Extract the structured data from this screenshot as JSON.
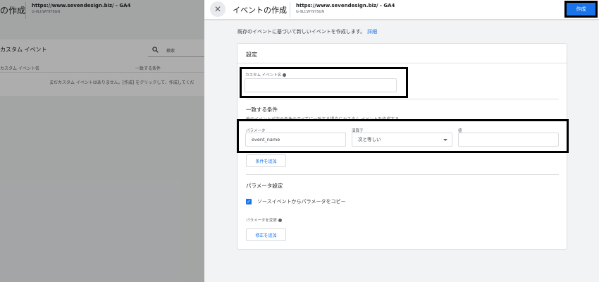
{
  "background": {
    "title": "の作成",
    "site": "https://www.sevendesign.biz/ - GA4",
    "property_id": "G-9LCWY9YSGN",
    "list_title": "カスタム イベント",
    "search_placeholder": "検索",
    "columns": [
      "カスタム イベント名",
      "一致する条件"
    ],
    "empty_message": "まだカスタム イベントはありません。[作成] をクリックして、作成してくだ"
  },
  "panel": {
    "title": "イベントの作成",
    "site": "https://www.sevendesign.biz/ - GA4",
    "property_id": "G-9LCWY9YSGN",
    "create_label": "作成",
    "description": "既存のイベントに基づいて新しいイベントを作成します。",
    "details_link": "詳細"
  },
  "settings": {
    "title": "設定",
    "custom_event_name_label": "カスタム イベント名",
    "custom_event_name_value": "",
    "match_title": "一致する条件",
    "match_subtitle": "他のイベントが次の条件のすべてに一致する場合にカスタム イベントを作成する",
    "parameter_label": "パラメータ",
    "parameter_value": "event_name",
    "operator_label": "演算子",
    "operator_value": "次と等しい",
    "value_label": "値",
    "value_value": "",
    "add_condition_label": "条件を追加",
    "param_settings_title": "パラメータ設定",
    "copy_params_label": "ソースイベントからパラメータをコピー",
    "copy_params_checked": true,
    "modify_params_label": "パラメータを変更",
    "add_modification_label": "修正を追加"
  }
}
